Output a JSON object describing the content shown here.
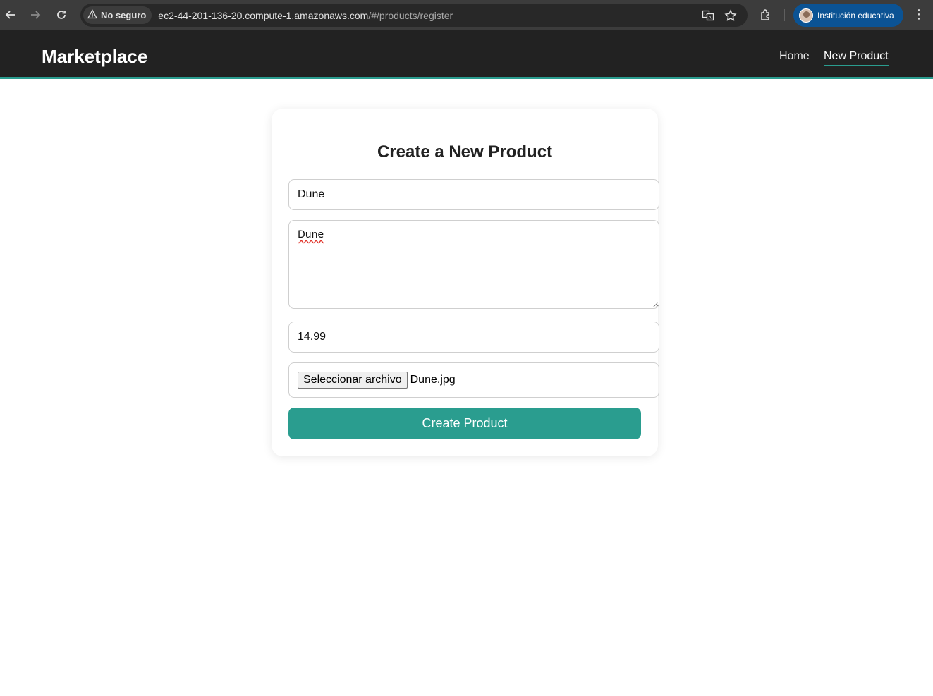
{
  "browser": {
    "security_label": "No seguro",
    "url_host": "ec2-44-201-136-20.compute-1.amazonaws.com",
    "url_path": "/#/products/register",
    "profile_label": "Institución educativa",
    "icons": [
      "back-arrow-icon",
      "forward-arrow-icon",
      "reload-icon",
      "warning-icon",
      "translate-icon",
      "star-icon",
      "extensions-icon",
      "kebab-menu-icon"
    ]
  },
  "header": {
    "brand": "Marketplace",
    "nav": [
      {
        "label": "Home",
        "active": false
      },
      {
        "label": "New Product",
        "active": true
      }
    ]
  },
  "form": {
    "title": "Create a New Product",
    "name_value": "Dune",
    "description_value": "Dune",
    "price_value": "14.99",
    "file_button_label": "Seleccionar archivo",
    "file_name": "Dune.jpg",
    "submit_label": "Create Product"
  },
  "colors": {
    "accent": "#2a9d8f",
    "header_bg": "#222222",
    "profile_chip": "#0b5394"
  }
}
